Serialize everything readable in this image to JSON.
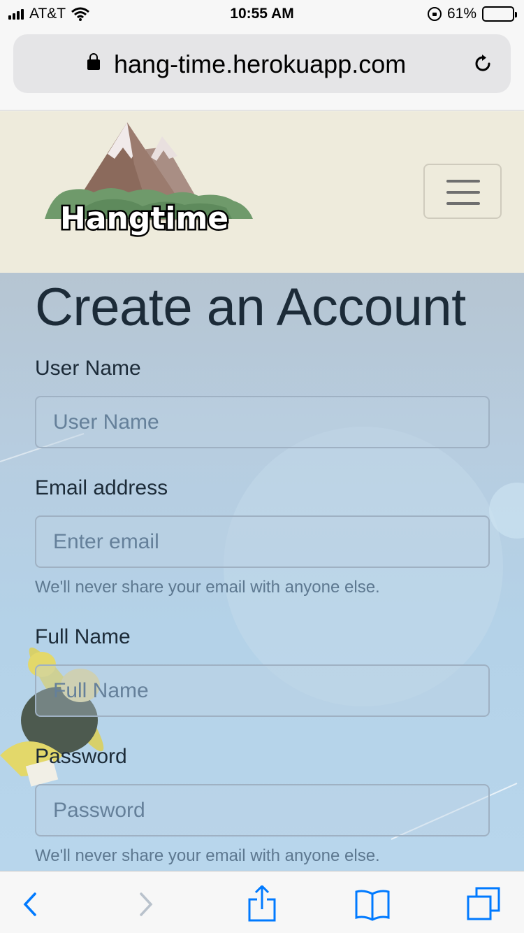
{
  "status_bar": {
    "carrier": "AT&T",
    "time": "10:55 AM",
    "battery": "61%",
    "battery_level": 0.61,
    "icons": [
      "signal-icon",
      "wifi-icon",
      "orientation-lock-icon",
      "battery-icon"
    ]
  },
  "address_bar": {
    "url": "hang-time.herokuapp.com",
    "icons": [
      "lock-icon",
      "reload-icon"
    ]
  },
  "site_header": {
    "logo_text": "Hangtime",
    "menu_icon": "hamburger-icon",
    "background": "#eeebdc"
  },
  "form": {
    "title": "Create an Account",
    "fields": [
      {
        "label": "User Name",
        "placeholder": "User Name",
        "value": ""
      },
      {
        "label": "Email address",
        "placeholder": "Enter email",
        "value": "",
        "help": "We'll never share your email with anyone else."
      },
      {
        "label": "Full Name",
        "placeholder": "Full Name",
        "value": ""
      },
      {
        "label": "Password",
        "placeholder": "Password",
        "value": "",
        "help": "We'll never share your email with anyone else."
      }
    ]
  },
  "toolbar": {
    "icons": [
      "back-icon",
      "forward-icon",
      "share-icon",
      "bookmarks-icon",
      "tabs-icon"
    ],
    "accent": "#007aff"
  }
}
